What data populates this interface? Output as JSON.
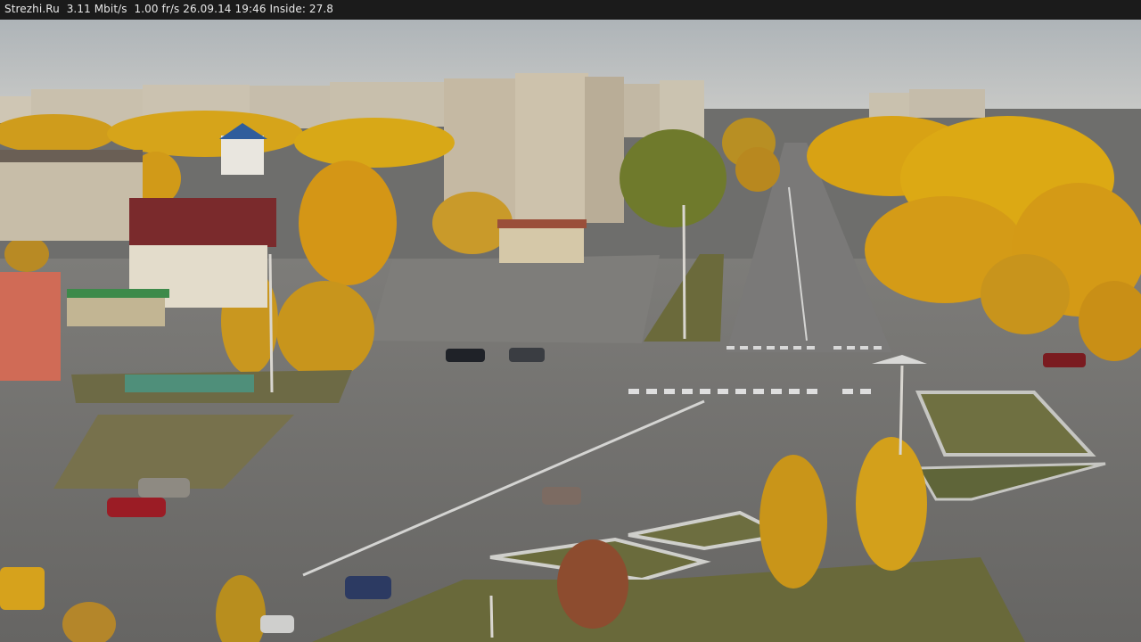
{
  "overlay": {
    "site": "Strezhi.Ru",
    "bitrate": "3.11 Mbit/s",
    "framerate": "1.00 fr/s",
    "date": "26.09.14",
    "time": "19:46",
    "inside_label": "Inside:",
    "inside_value": "27.8"
  },
  "colors": {
    "sky": "#b9bdbf",
    "asphalt": "#6f6f6d",
    "foliage_gold": "#d8a215",
    "foliage_dark": "#7a7a2c",
    "grass": "#6c6b3c",
    "building_light": "#c9c0ad",
    "overlay_bar": "#1b1b1b"
  }
}
